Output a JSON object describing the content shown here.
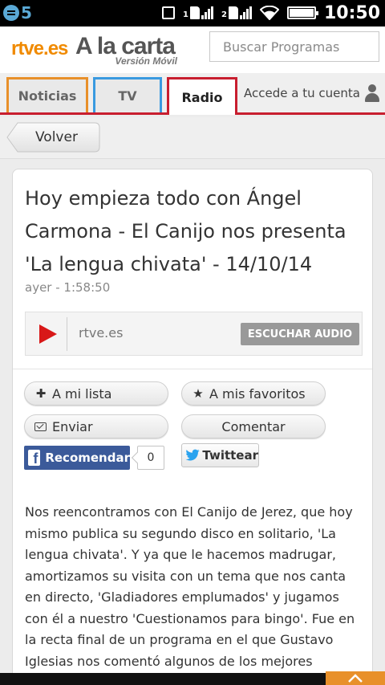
{
  "status_bar": {
    "notification_count": "5",
    "sim1_label": "1",
    "sim2_label": "2",
    "time": "10:50",
    "icons": [
      "chat-bubble-icon",
      "screenshot-icon",
      "sim-signal-icon",
      "wifi-icon",
      "battery-icon"
    ]
  },
  "header": {
    "logo_brand": "rtve.es",
    "logo_title": "A la carta",
    "logo_subtitle": "Versión Móvil",
    "search_placeholder": "Buscar Programas"
  },
  "nav": {
    "tabs": [
      {
        "label": "Noticias",
        "color": "#e8902a"
      },
      {
        "label": "TV",
        "color": "#3a9ae0"
      },
      {
        "label": "Radio",
        "color": "#c81e2f",
        "active": true
      }
    ],
    "account_label": "Accede a tu cuenta"
  },
  "back": {
    "label": "Volver"
  },
  "article": {
    "title": "Hoy empieza todo con Ángel Carmona - El Canijo nos presenta 'La lengua chivata' - 14/10/14",
    "date": "ayer - 1:58:50",
    "player": {
      "domain": "rtve.es",
      "listen_label": "ESCUCHAR AUDIO"
    },
    "actions": {
      "add_list": "A mi lista",
      "add_favorites": "A mis favoritos",
      "send": "Enviar",
      "comment": "Comentar",
      "recommend": "Recomendar",
      "recommend_count": "0",
      "tweet": "Twittear"
    },
    "description": "Nos reencontramos con El Canijo de Jerez, que hoy mismo publica su segundo disco en solitario, 'La lengua chivata'. Y ya que le hacemos madrugar, amortizamos su visita con un tema que nos canta en directo, 'Gladiadores emplumados' y jugamos con él a nuestro 'Cuestionamos para bingo'. Fue en la recta final de un programa en el que Gustavo Iglesias nos comentó algunos de los mejores"
  },
  "colors": {
    "accent_orange": "#e8902a",
    "accent_blue": "#3a9ae0",
    "accent_red": "#c81e2f",
    "facebook_blue": "#3b5a9a",
    "twitter_blue": "#2aa3ef"
  }
}
